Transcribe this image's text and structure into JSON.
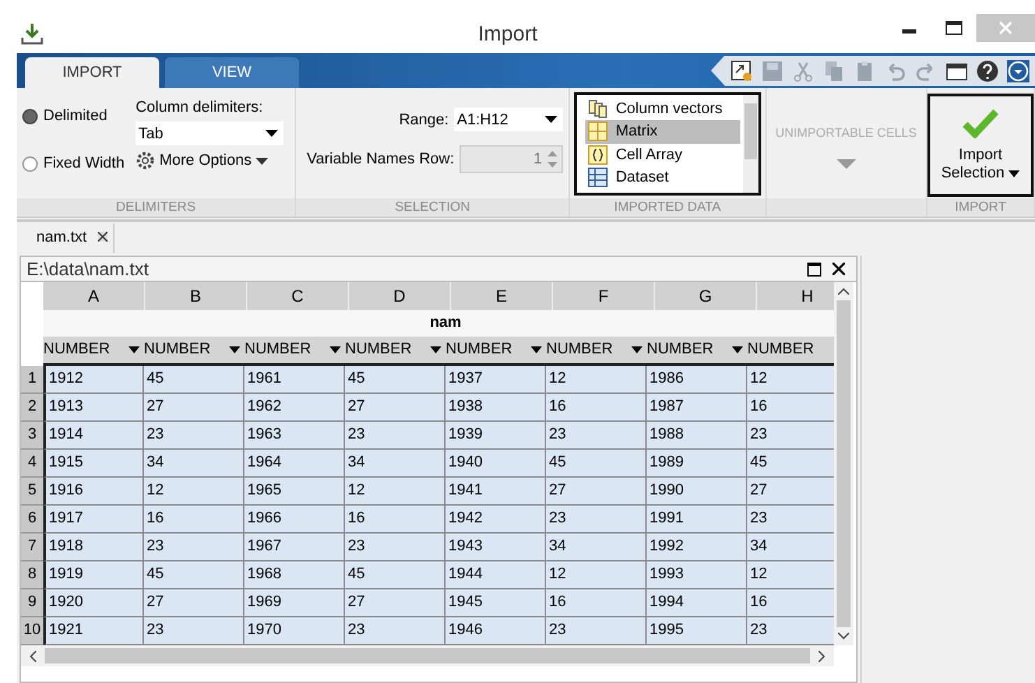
{
  "window": {
    "title": "Import"
  },
  "ribbon_tabs": [
    {
      "label": "IMPORT",
      "selected": true
    },
    {
      "label": "VIEW",
      "selected": false
    }
  ],
  "delimiters": {
    "options": [
      {
        "label": "Delimited",
        "selected": true
      },
      {
        "label": "Fixed Width",
        "selected": false
      }
    ],
    "column_delimiters_label": "Column delimiters:",
    "column_delimiters_value": "Tab",
    "more_options": "More Options",
    "group_label": "DELIMITERS"
  },
  "selection": {
    "range_label": "Range:",
    "range_value": "A1:H12",
    "names_row_label": "Variable Names Row:",
    "names_row_value": "1",
    "group_label": "SELECTION"
  },
  "imported_data": {
    "items": [
      {
        "kind": "vectors",
        "label": "Column vectors",
        "selected": false
      },
      {
        "kind": "matrix",
        "label": "Matrix",
        "selected": true
      },
      {
        "kind": "cells",
        "label": "Cell Array",
        "selected": false
      },
      {
        "kind": "dataset",
        "label": "Dataset",
        "selected": false
      }
    ],
    "group_label": "IMPORTED DATA"
  },
  "unimportable": {
    "label": "UNIMPORTABLE CELLS"
  },
  "import": {
    "button": "Import Selection",
    "group_label": "IMPORT"
  },
  "document_tab": {
    "label": "nam.txt"
  },
  "panel": {
    "title": "E:\\data\\nam.txt"
  },
  "table": {
    "columns": [
      "A",
      "B",
      "C",
      "D",
      "E",
      "F",
      "G",
      "H"
    ],
    "variable_name": "nam",
    "types": [
      "NUMBER",
      "NUMBER",
      "NUMBER",
      "NUMBER",
      "NUMBER",
      "NUMBER",
      "NUMBER",
      "NUMBER"
    ],
    "rows": [
      {
        "number": "1",
        "cells": [
          "1912",
          "45",
          "1961",
          "45",
          "1937",
          "12",
          "1986",
          "12"
        ]
      },
      {
        "number": "2",
        "cells": [
          "1913",
          "27",
          "1962",
          "27",
          "1938",
          "16",
          "1987",
          "16"
        ]
      },
      {
        "number": "3",
        "cells": [
          "1914",
          "23",
          "1963",
          "23",
          "1939",
          "23",
          "1988",
          "23"
        ]
      },
      {
        "number": "4",
        "cells": [
          "1915",
          "34",
          "1964",
          "34",
          "1940",
          "45",
          "1989",
          "45"
        ]
      },
      {
        "number": "5",
        "cells": [
          "1916",
          "12",
          "1965",
          "12",
          "1941",
          "27",
          "1990",
          "27"
        ]
      },
      {
        "number": "6",
        "cells": [
          "1917",
          "16",
          "1966",
          "16",
          "1942",
          "23",
          "1991",
          "23"
        ]
      },
      {
        "number": "7",
        "cells": [
          "1918",
          "23",
          "1967",
          "23",
          "1943",
          "34",
          "1992",
          "34"
        ]
      },
      {
        "number": "8",
        "cells": [
          "1919",
          "45",
          "1968",
          "45",
          "1944",
          "12",
          "1993",
          "12"
        ]
      },
      {
        "number": "9",
        "cells": [
          "1920",
          "27",
          "1969",
          "27",
          "1945",
          "16",
          "1994",
          "16"
        ]
      },
      {
        "number": "10",
        "cells": [
          "1921",
          "23",
          "1970",
          "23",
          "1946",
          "23",
          "1995",
          "23"
        ]
      }
    ]
  }
}
